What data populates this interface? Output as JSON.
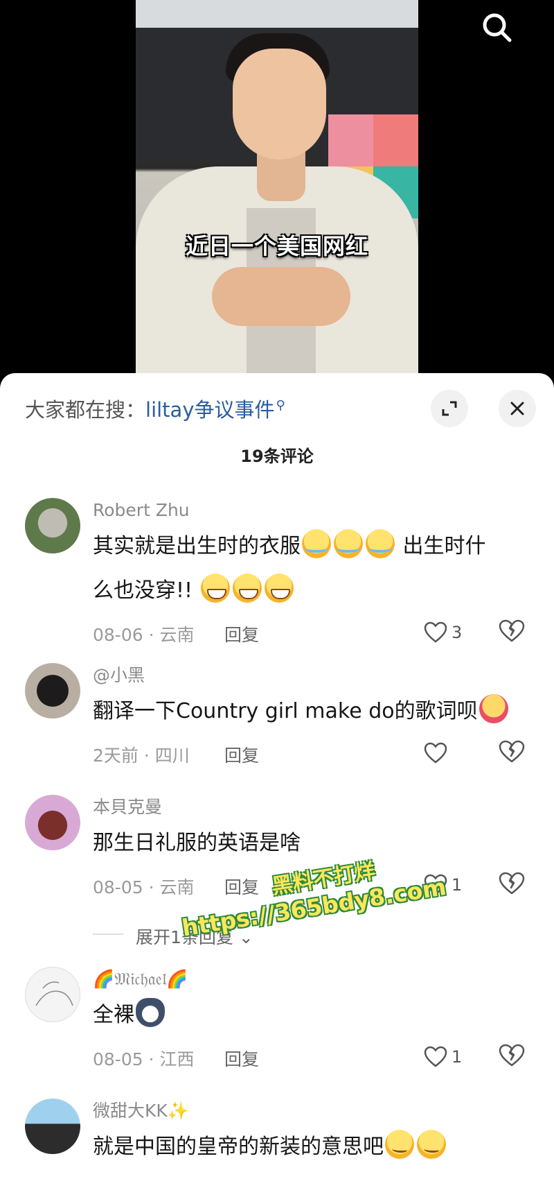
{
  "video": {
    "subtitle": "近日一个美国网红"
  },
  "search_button": {
    "icon": "search-icon"
  },
  "sheet": {
    "trend_prefix": "大家都在搜：",
    "trend_keyword": "liltay争议事件",
    "comment_count": "19条评论",
    "expand_icon": "expand-icon",
    "close_icon": "close-icon"
  },
  "comments": [
    {
      "name": "Robert Zhu",
      "text_line1": "其实就是出生时的衣服",
      "text_line1_tail": " 出生时什",
      "text_line2": "么也没穿!!",
      "date_loc": "08-06 · 云南",
      "reply": "回复",
      "likes": "3"
    },
    {
      "name": "@小黑",
      "text": "翻译一下Country girl make do的歌词呗",
      "date_loc": "2天前 · 四川",
      "reply": "回复",
      "likes": ""
    },
    {
      "name": "本貝克曼",
      "text": "那生日礼服的英语是啥",
      "date_loc": "08-05 · 云南",
      "reply": "回复",
      "likes": "1",
      "expand": "展开1条回复"
    },
    {
      "name": "🌈𝔐𝔦𝔠𝔥𝔞𝔢𝔩🌈",
      "text": "全裸",
      "date_loc": "08-05 · 江西",
      "reply": "回复",
      "likes": "1"
    },
    {
      "name": "微甜大KK",
      "text": "就是中国的皇帝的新装的意思吧"
    }
  ],
  "watermark": {
    "line1": "黑料不打烊",
    "line2": "https://365bdy8.com"
  }
}
